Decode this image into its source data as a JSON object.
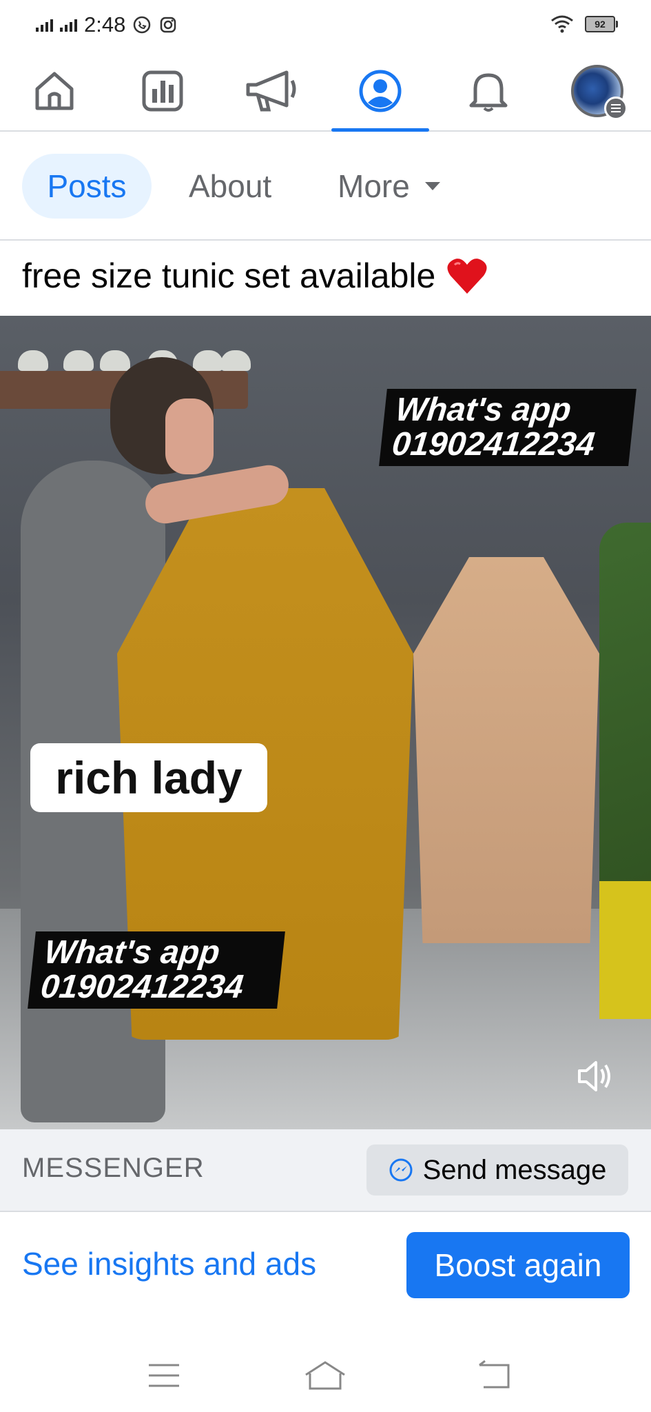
{
  "status_bar": {
    "time": "2:48",
    "battery": "92",
    "icons": [
      "signal-icon",
      "signal-icon",
      "whatsapp-status-icon",
      "instagram-status-icon",
      "wifi-icon",
      "battery-icon"
    ]
  },
  "top_nav": {
    "items": [
      {
        "name": "home",
        "icon": "home-icon",
        "active": false
      },
      {
        "name": "dashboard",
        "icon": "insights-icon",
        "active": false
      },
      {
        "name": "ads",
        "icon": "megaphone-icon",
        "active": false
      },
      {
        "name": "profile",
        "icon": "profile-icon",
        "active": true
      },
      {
        "name": "notifications",
        "icon": "bell-icon",
        "active": false
      },
      {
        "name": "menu",
        "icon": "avatar-menu-icon",
        "active": false
      }
    ],
    "accent_color": "#1877f2"
  },
  "tabs": {
    "posts": "Posts",
    "about": "About",
    "more": "More"
  },
  "post": {
    "caption": "free size tunic set available",
    "video": {
      "overlay_top_line1": "What's app",
      "overlay_top_line2": "01902412234",
      "overlay_bottom_line1": "What's app",
      "overlay_bottom_line2": "01902412234",
      "label": "rich lady"
    }
  },
  "messenger": {
    "label": "MESSENGER",
    "send_button": "Send message"
  },
  "actions": {
    "insights_link": "See insights and ads",
    "boost_button": "Boost again"
  },
  "system_nav": [
    "menu-icon",
    "home-icon",
    "back-icon"
  ]
}
